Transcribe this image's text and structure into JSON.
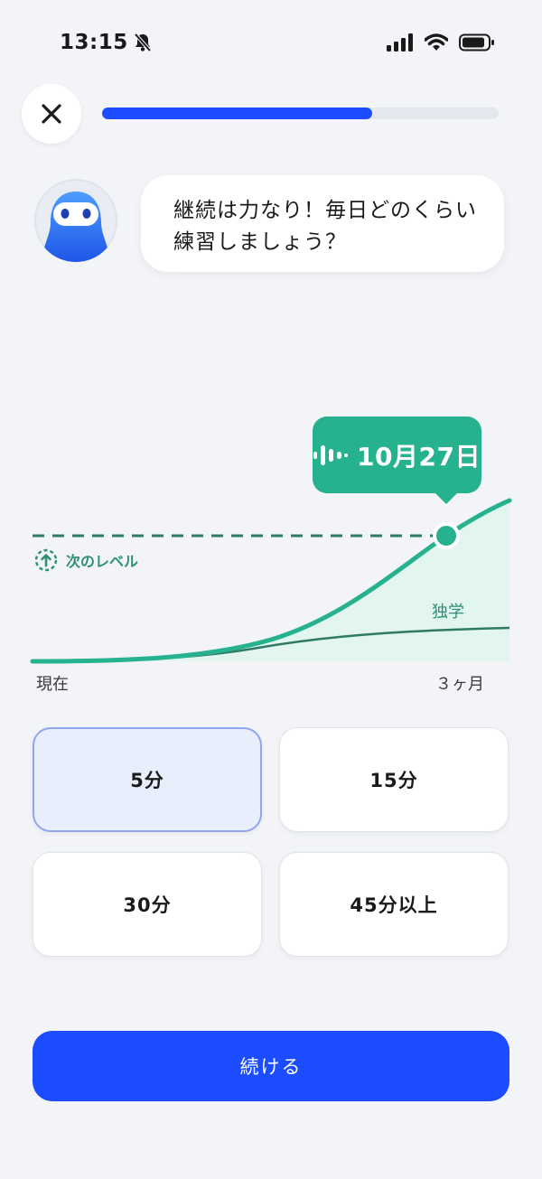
{
  "status_bar": {
    "time": "13:15"
  },
  "onboarding": {
    "progress": 0.68
  },
  "assistant": {
    "message": "継続は力なり！毎日どのくらい練習しましょう？"
  },
  "chart_data": {
    "type": "line",
    "x_start_label": "現在",
    "x_end_label": "３ヶ月",
    "threshold_label": "次のレベル",
    "callout_label": "10月27日",
    "series": [
      {
        "name": "",
        "description": "with app"
      },
      {
        "name": "独学"
      }
    ],
    "colors": {
      "main": "#26b28f",
      "secondary": "#2f7a66",
      "threshold": "#2e7a62"
    }
  },
  "options": [
    {
      "label": "5分",
      "selected": true
    },
    {
      "label": "15分",
      "selected": false
    },
    {
      "label": "30分",
      "selected": false
    },
    {
      "label": "45分以上",
      "selected": false
    }
  ],
  "continue_label": "続ける",
  "colors": {
    "accent": "#1b4cff",
    "green": "#26b28f",
    "background": "#f2f4f8"
  }
}
